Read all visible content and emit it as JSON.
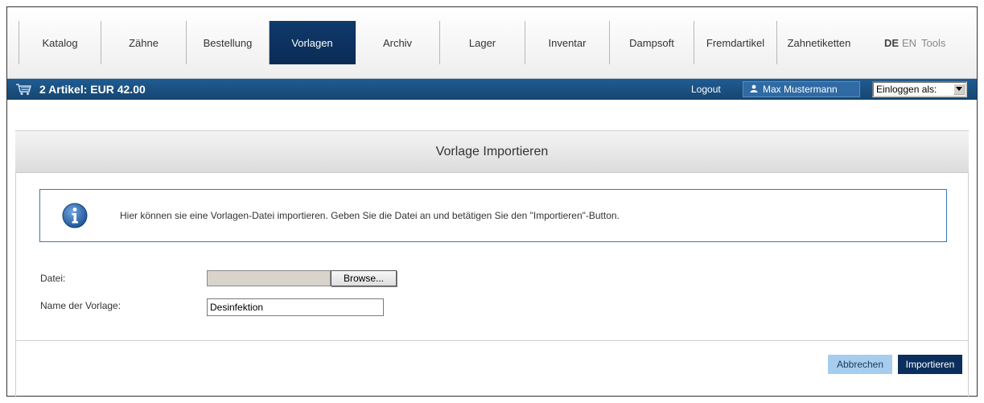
{
  "nav": {
    "items": [
      {
        "label": "Katalog",
        "active": false
      },
      {
        "label": "Zähne",
        "active": false
      },
      {
        "label": "Bestellung",
        "active": false
      },
      {
        "label": "Vorlagen",
        "active": true
      },
      {
        "label": "Archiv",
        "active": false
      },
      {
        "label": "Lager",
        "active": false
      },
      {
        "label": "Inventar",
        "active": false
      },
      {
        "label": "Dampsoft",
        "active": false
      },
      {
        "label": "Fremdartikel",
        "active": false
      },
      {
        "label": "Zahnetiketten",
        "active": false
      }
    ],
    "lang_de": "DE",
    "lang_en": "EN",
    "tools": "Tools"
  },
  "bar": {
    "cart_summary": "2 Artikel: EUR 42.00",
    "logout": "Logout",
    "user_name": "Max Mustermann",
    "login_as": "Einloggen als:"
  },
  "panel": {
    "title": "Vorlage Importieren",
    "info_text": "Hier können sie eine Vorlagen-Datei importieren. Geben Sie die Datei an und betätigen Sie den \"Importieren\"-Button.",
    "file_label": "Datei:",
    "browse_label": "Browse...",
    "name_label": "Name der Vorlage:",
    "name_value": "Desinfektion",
    "cancel_label": "Abbrechen",
    "import_label": "Importieren"
  },
  "colors": {
    "nav_active": "#0f3a6b",
    "bar_blue": "#1f5c93",
    "cancel_bg": "#a7cdee",
    "import_bg": "#0a2f5c",
    "info_border": "#3c75b8"
  },
  "icons": {
    "cart": "shopping-cart-icon",
    "user": "user-icon",
    "info": "info-icon",
    "dropdown": "chevron-down-icon"
  }
}
